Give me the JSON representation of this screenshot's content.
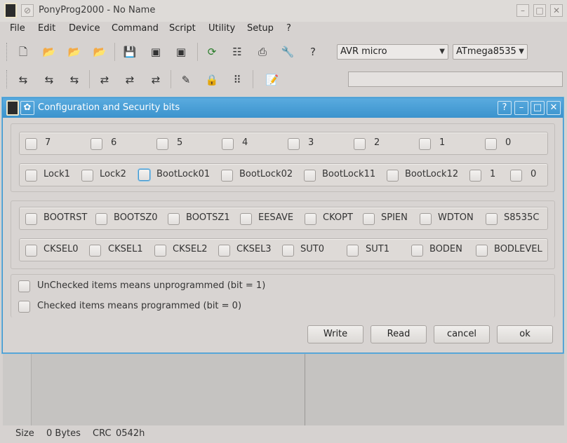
{
  "app": {
    "title": "PonyProg2000 - No Name",
    "menu": [
      "File",
      "Edit",
      "Device",
      "Command",
      "Script",
      "Utility",
      "Setup",
      "?"
    ],
    "device_family": "AVR micro",
    "device_model": "ATmega8535",
    "status": {
      "size_label": "Size",
      "size_value": "0 Bytes",
      "crc_label": "CRC",
      "crc_value": "0542h"
    }
  },
  "dialog": {
    "title": "Configuration and Security bits",
    "bit_row": [
      "7",
      "6",
      "5",
      "4",
      "3",
      "2",
      "1",
      "0"
    ],
    "lock_row": [
      "Lock1",
      "Lock2",
      "BootLock01",
      "BootLock02",
      "BootLock11",
      "BootLock12",
      "1",
      "0"
    ],
    "fuse_row1": [
      "BOOTRST",
      "BOOTSZ0",
      "BOOTSZ1",
      "EESAVE",
      "CKOPT",
      "SPIEN",
      "WDTON",
      "S8535C"
    ],
    "fuse_row2": [
      "CKSEL0",
      "CKSEL1",
      "CKSEL2",
      "CKSEL3",
      "SUT0",
      "SUT1",
      "BODEN",
      "BODLEVEL"
    ],
    "legend_unchecked": "UnChecked items means unprogrammed (bit = 1)",
    "legend_checked": "Checked items means programmed (bit = 0)",
    "buttons": {
      "write": "Write",
      "read": "Read",
      "cancel": "cancel",
      "ok": "ok"
    }
  }
}
